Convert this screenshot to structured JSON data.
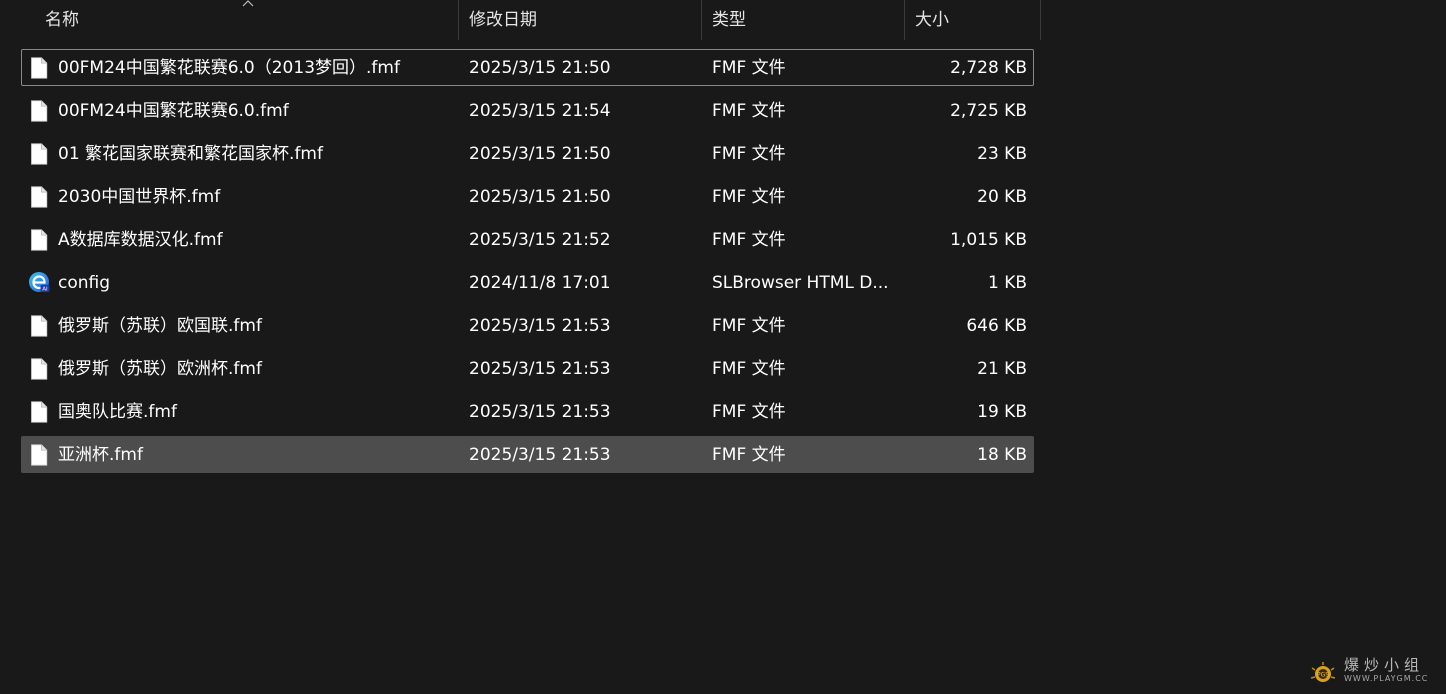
{
  "header": {
    "name": "名称",
    "date": "修改日期",
    "type": "类型",
    "size": "大小"
  },
  "files": [
    {
      "name": "00FM24中国繁花联赛6.0（2013梦回）.fmf",
      "date": "2025/3/15 21:50",
      "type": "FMF 文件",
      "size": "2,728 KB",
      "icon": "file-icon",
      "state": "focused"
    },
    {
      "name": "00FM24中国繁花联赛6.0.fmf",
      "date": "2025/3/15 21:54",
      "type": "FMF 文件",
      "size": "2,725 KB",
      "icon": "file-icon",
      "state": ""
    },
    {
      "name": "01 繁花国家联赛和繁花国家杯.fmf",
      "date": "2025/3/15 21:50",
      "type": "FMF 文件",
      "size": "23 KB",
      "icon": "file-icon",
      "state": ""
    },
    {
      "name": "2030中国世界杯.fmf",
      "date": "2025/3/15 21:50",
      "type": "FMF 文件",
      "size": "20 KB",
      "icon": "file-icon",
      "state": ""
    },
    {
      "name": "A数据库数据汉化.fmf",
      "date": "2025/3/15 21:52",
      "type": "FMF 文件",
      "size": "1,015 KB",
      "icon": "file-icon",
      "state": ""
    },
    {
      "name": "config",
      "date": "2024/11/8 17:01",
      "type": "SLBrowser HTML D...",
      "size": "1 KB",
      "icon": "browser-icon",
      "state": ""
    },
    {
      "name": "俄罗斯（苏联）欧国联.fmf",
      "date": "2025/3/15 21:53",
      "type": "FMF 文件",
      "size": "646 KB",
      "icon": "file-icon",
      "state": ""
    },
    {
      "name": "俄罗斯（苏联）欧洲杯.fmf",
      "date": "2025/3/15 21:53",
      "type": "FMF 文件",
      "size": "21 KB",
      "icon": "file-icon",
      "state": ""
    },
    {
      "name": "国奥队比赛.fmf",
      "date": "2025/3/15 21:53",
      "type": "FMF 文件",
      "size": "19 KB",
      "icon": "file-icon",
      "state": ""
    },
    {
      "name": "亚洲杯.fmf",
      "date": "2025/3/15 21:53",
      "type": "FMF 文件",
      "size": "18 KB",
      "icon": "file-icon",
      "state": "selected"
    }
  ],
  "watermark": {
    "text": "爆炒小组",
    "sub": "WWW.PLAYGM.CC"
  },
  "colors": {
    "background": "#191919",
    "selected": "#4d4d4d",
    "focus_border": "#8a8a8a"
  }
}
